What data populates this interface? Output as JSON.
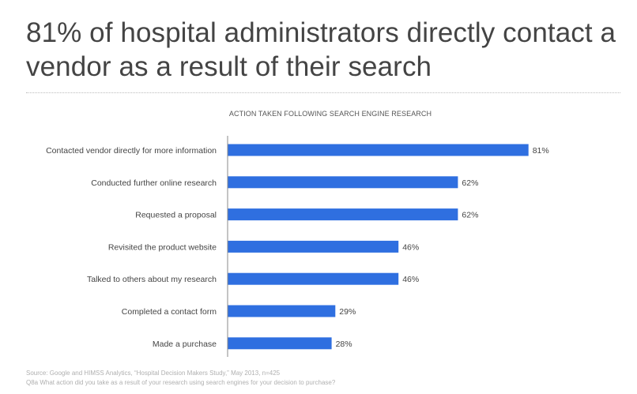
{
  "headline": "81% of hospital administrators directly contact a vendor as a result of their search",
  "chart_data": {
    "type": "bar",
    "orientation": "horizontal",
    "title": "ACTION TAKEN FOLLOWING SEARCH ENGINE RESEARCH",
    "categories": [
      "Contacted vendor directly for more information",
      "Conducted further online research",
      "Requested a proposal",
      "Revisited the product website",
      "Talked to others about my research",
      "Completed a contact form",
      "Made a purchase"
    ],
    "values": [
      81,
      62,
      62,
      46,
      46,
      29,
      28
    ],
    "value_labels": [
      "81%",
      "62%",
      "62%",
      "46%",
      "46%",
      "29%",
      "28%"
    ],
    "unit": "%",
    "xlim": [
      0,
      100
    ],
    "grid": false,
    "bar_color": "#2f6fe0",
    "axis_color": "#888888"
  },
  "footnotes": {
    "source": "Source: Google and HIMSS Analytics, “Hospital Decision Makers Study,” May 2013, n=425",
    "question": "Q8a What action did you take as a result of your research using search engines for your decision to purchase?"
  }
}
